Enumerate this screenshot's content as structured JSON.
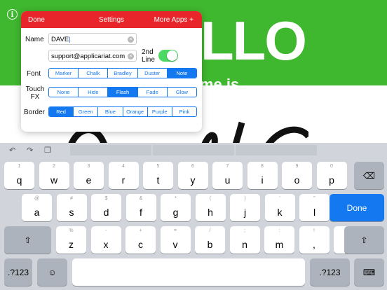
{
  "background": {
    "info_label": "i",
    "hello_text": "LLO",
    "subtitle": "me is"
  },
  "settings": {
    "done_label": "Done",
    "title": "Settings",
    "more_label": "More Apps +",
    "name_label": "Name",
    "name_value": "DAVE",
    "email_value": "support@applicariat.com",
    "second_line_label": "2nd Line",
    "font_label": "Font",
    "font_options": [
      "Marker",
      "Chalk",
      "Bradley",
      "Duster",
      "Note"
    ],
    "font_selected": "Note",
    "touchfx_label": "Touch FX",
    "touchfx_options": [
      "None",
      "Hide",
      "Flash",
      "Fade",
      "Glow"
    ],
    "touchfx_selected": "Flash",
    "border_label": "Border",
    "border_options": [
      "Red",
      "Green",
      "Blue",
      "Orange",
      "Purple",
      "Pink"
    ],
    "border_selected": "Red"
  },
  "keyboard": {
    "row1": [
      [
        "1",
        "q"
      ],
      [
        "2",
        "w"
      ],
      [
        "3",
        "e"
      ],
      [
        "4",
        "r"
      ],
      [
        "5",
        "t"
      ],
      [
        "6",
        "y"
      ],
      [
        "7",
        "u"
      ],
      [
        "8",
        "i"
      ],
      [
        "9",
        "o"
      ],
      [
        "0",
        "p"
      ]
    ],
    "row2": [
      [
        "@",
        "a"
      ],
      [
        "#",
        "s"
      ],
      [
        "$",
        "d"
      ],
      [
        "&",
        "f"
      ],
      [
        "*",
        "g"
      ],
      [
        "(",
        "h"
      ],
      [
        ")",
        "j"
      ],
      [
        "'",
        "k"
      ],
      [
        "\"",
        "l"
      ]
    ],
    "row3": [
      [
        "%",
        "z"
      ],
      [
        "-",
        "x"
      ],
      [
        "+",
        "c"
      ],
      [
        "=",
        "v"
      ],
      [
        "/",
        "b"
      ],
      [
        ";",
        "n"
      ],
      [
        ":",
        "m"
      ],
      [
        "!",
        ","
      ],
      [
        "?",
        "."
      ]
    ],
    "done_label": "Done",
    "numbers_label": ".?123",
    "emoji_icon": "emoji-icon",
    "colors": {
      "accent": "#1479f0",
      "header": "#e8252b",
      "green": "#3fb72f"
    }
  }
}
